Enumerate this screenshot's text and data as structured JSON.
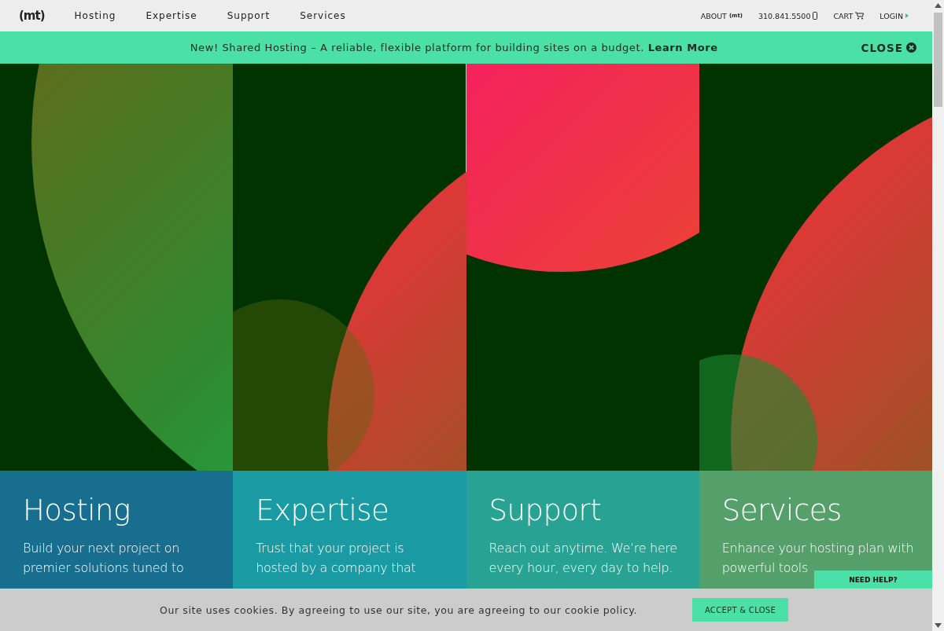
{
  "nav": {
    "logo": "(mt)",
    "links": [
      "Hosting",
      "Expertise",
      "Support",
      "Services"
    ],
    "about": "ABOUT",
    "about_logo": "(mt)",
    "phone": "310.841.5500",
    "cart": "CART",
    "login": "LOGIN"
  },
  "banner": {
    "message": "New! Shared Hosting – A reliable, flexible platform for building sites on a budget.",
    "link": "Learn More",
    "close": "CLOSE"
  },
  "panels": [
    {
      "title": "Hosting",
      "description": "Build your next project on premier solutions tuned to",
      "color": "#176e8e"
    },
    {
      "title": "Expertise",
      "description": "Trust that your project is hosted by a company that",
      "color": "#1a9ba3"
    },
    {
      "title": "Support",
      "description": "Reach out anytime. We’re here every hour, every day to help.",
      "color": "#28a292"
    },
    {
      "title": "Services",
      "description": "Enhance your hosting plan with powerful tools",
      "color": "#55a06a"
    }
  ],
  "need_help": "NEED HELP?",
  "cookie": {
    "message": "Our site uses cookies. By agreeing to use our site, you are agreeing to our cookie policy.",
    "button": "ACCEPT & CLOSE"
  }
}
